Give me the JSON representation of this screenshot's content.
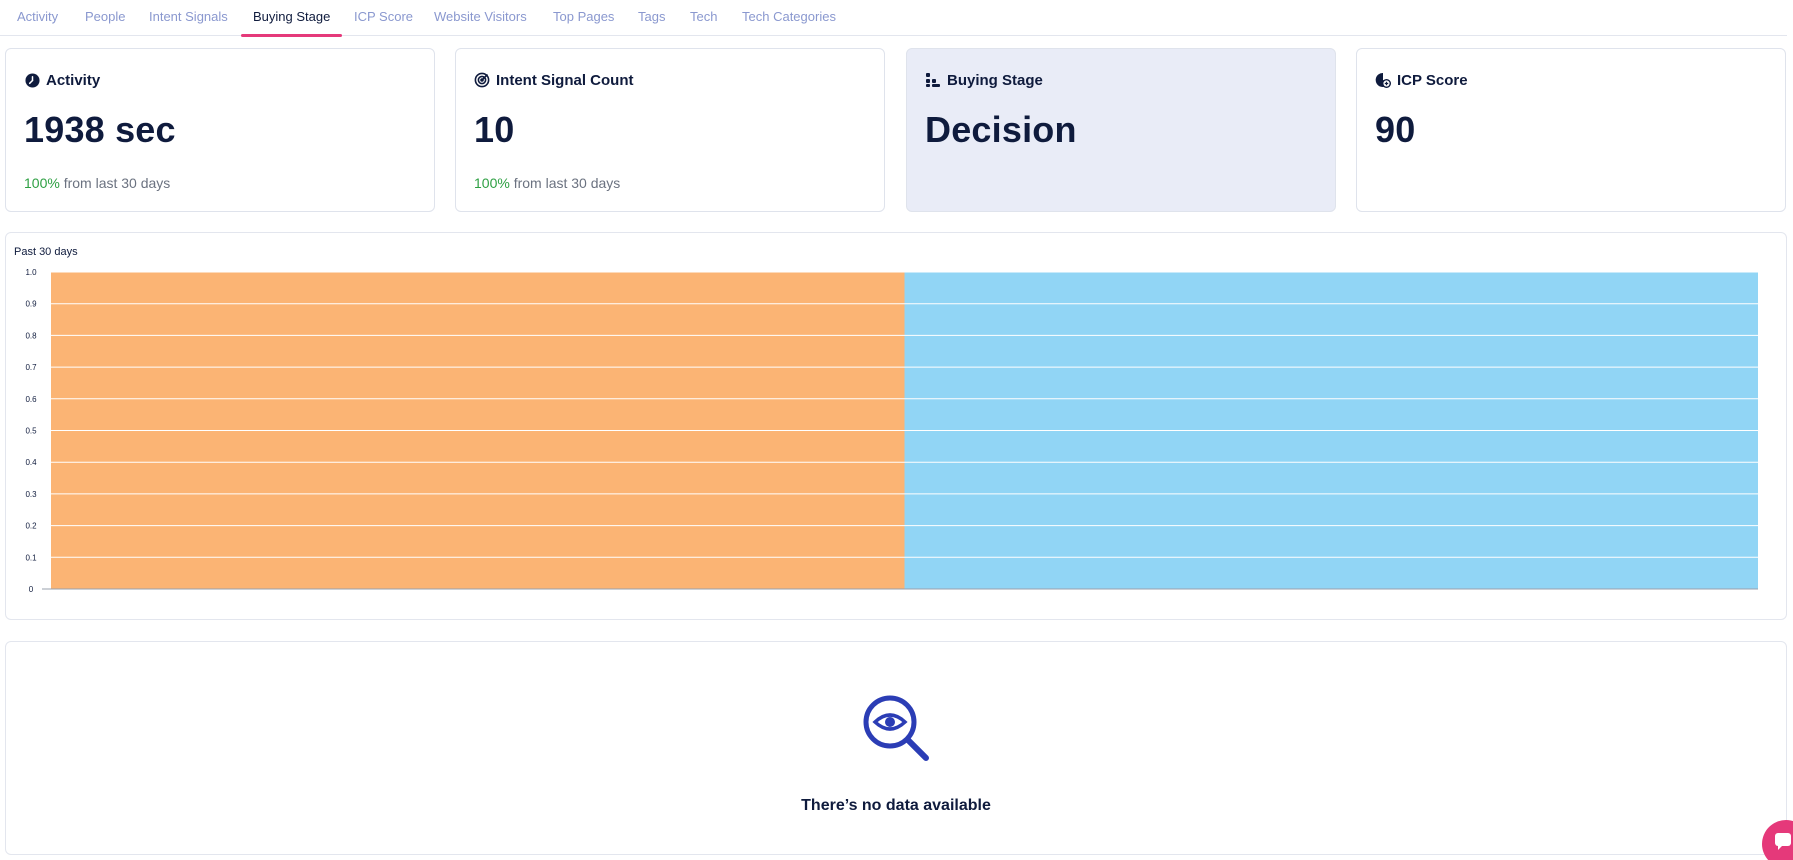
{
  "tabs": [
    {
      "label": "Activity"
    },
    {
      "label": "People"
    },
    {
      "label": "Intent Signals"
    },
    {
      "label": "Buying Stage",
      "active": true
    },
    {
      "label": "ICP Score"
    },
    {
      "label": "Website Visitors"
    },
    {
      "label": "Top Pages"
    },
    {
      "label": "Tags"
    },
    {
      "label": "Tech"
    },
    {
      "label": "Tech Categories"
    }
  ],
  "cards": [
    {
      "title": "Activity",
      "value": "1938 sec",
      "change_pct": "100%",
      "change_text": " from last 30 days",
      "icon": "clock-icon"
    },
    {
      "title": "Intent Signal Count",
      "value": "10",
      "change_pct": "100%",
      "change_text": " from last 30 days",
      "icon": "radar-icon"
    },
    {
      "title": "Buying Stage",
      "value": "Decision",
      "icon": "stage-icon"
    },
    {
      "title": "ICP Score",
      "value": "90",
      "icon": "score-icon"
    }
  ],
  "chart": {
    "title": "Past 30 days"
  },
  "chart_data": {
    "type": "bar",
    "title": "Past 30 days",
    "categories": [
      "",
      ""
    ],
    "values": [
      1,
      1
    ],
    "colors": [
      "#fbb474",
      "#91d5f5"
    ],
    "ylim": [
      0,
      1
    ],
    "yticks": [
      "0",
      "0.1",
      "0.2",
      "0.3",
      "0.4",
      "0.5",
      "0.6",
      "0.7",
      "0.8",
      "0.9",
      "1.0"
    ],
    "grid": true
  },
  "empty_state": {
    "message": "There’s no data available",
    "icon": "search-eye-icon"
  },
  "colors": {
    "accent": "#e5397a",
    "positive": "#2ea043",
    "tab_inactive": "#8a98cf",
    "icon_blue": "#2b3db5"
  }
}
